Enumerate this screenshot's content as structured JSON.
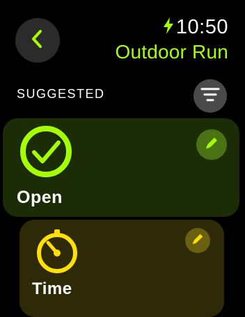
{
  "status": {
    "time": "10:50",
    "charging_color": "#a6ff00"
  },
  "header": {
    "back_icon": "chevron-left-icon",
    "title": "Outdoor Run",
    "title_color": "#a6ff00"
  },
  "section": {
    "label": "SUGGESTED",
    "filter_icon": "filter-icon"
  },
  "cards": [
    {
      "label": "Open",
      "icon": "checkmark-ring-icon",
      "accent": "#a6ff00",
      "edit_icon": "pencil-icon"
    },
    {
      "label": "Time",
      "icon": "stopwatch-icon",
      "accent": "#ffe100",
      "edit_icon": "pencil-icon"
    }
  ]
}
